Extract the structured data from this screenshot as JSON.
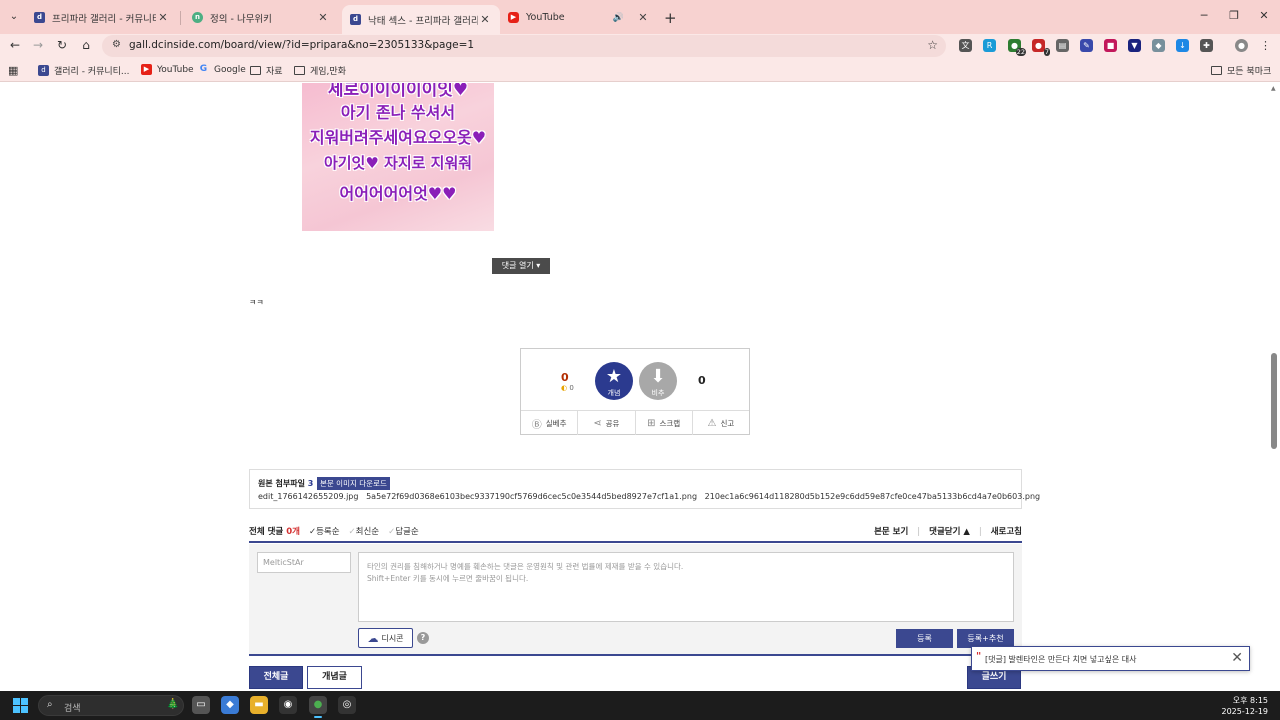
{
  "browser": {
    "tabs": [
      {
        "title": "프리파라 갤러리 - 커뮤니티 포",
        "favicon": "dc-icon",
        "active": false
      },
      {
        "title": "정의 - 나무위키",
        "favicon": "namu-icon",
        "active": false
      },
      {
        "title": "낙태 섹스 - 프리파라 갤러리",
        "favicon": "dc-icon",
        "active": true
      },
      {
        "title": "YouTube",
        "favicon": "youtube-icon",
        "active": false,
        "audio": true
      }
    ],
    "url": "gall.dcinside.com/board/view/?id=pripara&no=2305133&page=1",
    "bookmarks": [
      {
        "label": "갤러리 - 커뮤니티...",
        "icon": "dc-icon"
      },
      {
        "label": "YouTube",
        "icon": "youtube-icon"
      },
      {
        "label": "Google",
        "icon": "google-icon"
      },
      {
        "label": "자료",
        "icon": "folder-icon"
      },
      {
        "label": "게임,만화",
        "icon": "folder-icon"
      }
    ],
    "all_bookmarks": "모든 북마크",
    "extension_badges": [
      "22",
      "7"
    ]
  },
  "post": {
    "image_text": [
      "세로이이이이이잇♥",
      "아기 존나 쑤셔서",
      "지워버려주세여요오오옷♥",
      "아기잇♥ 자지로 지워줘",
      "어어어어어엇♥♥"
    ],
    "comment_toggle": "댓글 열기",
    "body_text": "ㅋㅋ"
  },
  "vote": {
    "up_count": "0",
    "up_sub": "0",
    "up_label": "개념",
    "down_label": "비추",
    "down_count": "0",
    "actions": [
      "실베추",
      "공유",
      "스크랩",
      "신고"
    ]
  },
  "attachments": {
    "title": "원본 첨부파일",
    "count": "3",
    "download_label": "본문 이미지 다운로드",
    "files": [
      "edit_1766142655209.jpg",
      "5a5e72f69d0368e6103bec9337190cf5769d6cec5c0e3544d5bed8927e7cf1a1.png",
      "210ec1a6c9614d118280d5b152e9c6dd59e87cfe0ce47ba5133b6cd4a7e0b603.png"
    ]
  },
  "comments": {
    "title": "전체 댓글",
    "count": "0개",
    "sort_options": [
      "등록순",
      "최신순",
      "답글순"
    ],
    "right_links": [
      "본문 보기",
      "댓글닫기 ▲",
      "새로고침"
    ],
    "nickname_placeholder": "MelticStAr",
    "textarea_placeholder": "타인의 권리를 침해하거나 명예를 훼손하는 댓글은 운영원칙 및 관련 법률에 제재를 받을 수 있습니다.\nShift+Enter 키를 동시에 누르면 줄바꿈이 됩니다.",
    "dccon_label": "디시콘",
    "submit_label": "등록",
    "submit_recommend_label": "등록+추천"
  },
  "bottom": {
    "all_posts": "전체글",
    "concept_posts": "개념글",
    "write": "글쓰기"
  },
  "toast": {
    "text": "[댓글] 발렌타인은 만든다 치면 넣고싶은 대사"
  },
  "taskbar": {
    "search_placeholder": "검색",
    "time": "오후 8:15",
    "date": "2025-12-19"
  }
}
